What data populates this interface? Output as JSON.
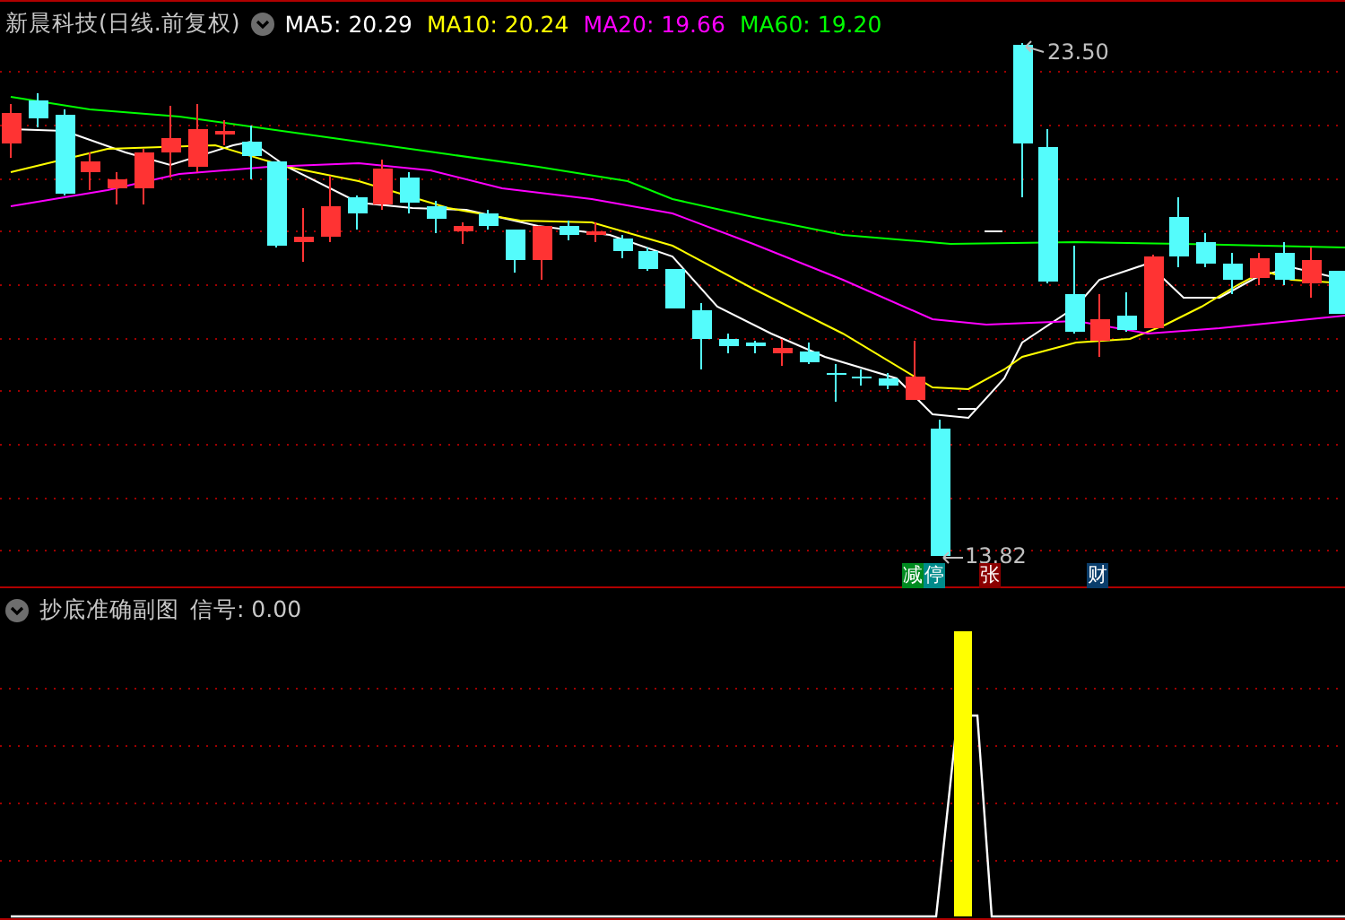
{
  "header": {
    "title": "新晨科技(日线.前复权)",
    "ma": [
      {
        "label": "MA5: 20.29",
        "color": "#ffffff"
      },
      {
        "label": "MA10: 20.24",
        "color": "#ffff00"
      },
      {
        "label": "MA20: 19.66",
        "color": "#ff00ff"
      },
      {
        "label": "MA60: 19.20",
        "color": "#00ff00"
      }
    ]
  },
  "price_chart": {
    "high_label": "23.50",
    "low_label": "13.82",
    "events": [
      {
        "text": "减",
        "color": "#008a20"
      },
      {
        "text": "停",
        "color": "#008b8b"
      },
      {
        "text": "张",
        "color": "#8b0000"
      },
      {
        "text": "财",
        "color": "#0a3d6b"
      }
    ]
  },
  "indicator": {
    "title": "抄底准确副图",
    "signal": "信号: 0.00"
  }
}
